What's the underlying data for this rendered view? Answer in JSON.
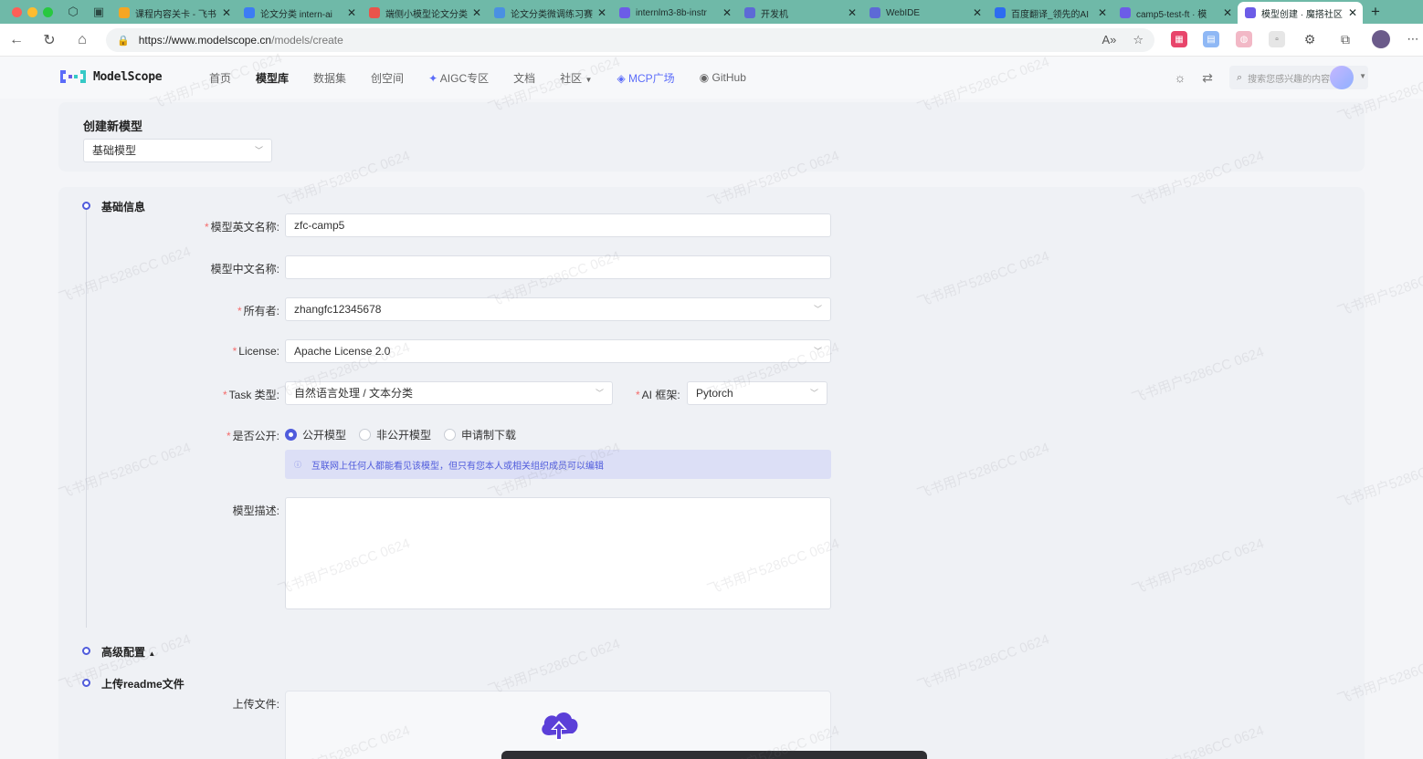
{
  "browser": {
    "tabs": [
      {
        "title": "课程内容关卡 - 飞书",
        "color": "#f5a623"
      },
      {
        "title": "论文分类 intern-ai",
        "color": "#3d7cf4"
      },
      {
        "title": "端侧小模型论文分类",
        "color": "#e9544b"
      },
      {
        "title": "论文分类微调练习赛",
        "color": "#4a90e2"
      },
      {
        "title": "internlm3-8b-instr",
        "color": "#6c5ce7"
      },
      {
        "title": "开发机",
        "color": "#5d6ad6"
      },
      {
        "title": "WebIDE",
        "color": "#5d6ad6"
      },
      {
        "title": "百度翻译_领先的AI",
        "color": "#2d6cf0"
      },
      {
        "title": "camp5-test-ft · 模",
        "color": "#6c5ce7"
      },
      {
        "title": "模型创建 · 魔搭社区",
        "color": "#6c5ce7",
        "active": true
      }
    ],
    "url_host": "https://www.modelscope.cn",
    "url_path": "/models/create"
  },
  "header": {
    "logo_text": "ModelScope",
    "nav": [
      "首页",
      "模型库",
      "数据集",
      "创空间",
      "AIGC专区",
      "文档",
      "社区",
      "MCP广场",
      "GitHub"
    ],
    "search_placeholder": "搜索您感兴趣的内容"
  },
  "create": {
    "title": "创建新模型",
    "model_type": "基础模型"
  },
  "form": {
    "section_basic": "基础信息",
    "en_name_label": "模型英文名称",
    "en_name_value": "zfc-camp5",
    "cn_name_label": "模型中文名称",
    "cn_name_value": "",
    "owner_label": "所有者",
    "owner_value": "zhangfc12345678",
    "license_label": "License",
    "license_value": "Apache License 2.0",
    "task_label": "Task 类型",
    "task_value": "自然语言处理 / 文本分类",
    "framework_label": "AI 框架",
    "framework_value": "Pytorch",
    "public_label": "是否公开",
    "public_options": [
      "公开模型",
      "非公开模型",
      "申请制下载"
    ],
    "public_notice": "互联网上任何人都能看见该模型，但只有您本人或相关组织成员可以编辑",
    "desc_label": "模型描述",
    "section_advanced": "高级配置",
    "section_readme": "上传readme文件",
    "upload_label": "上传文件"
  },
  "watermark": "飞书用户5286CC 0624"
}
